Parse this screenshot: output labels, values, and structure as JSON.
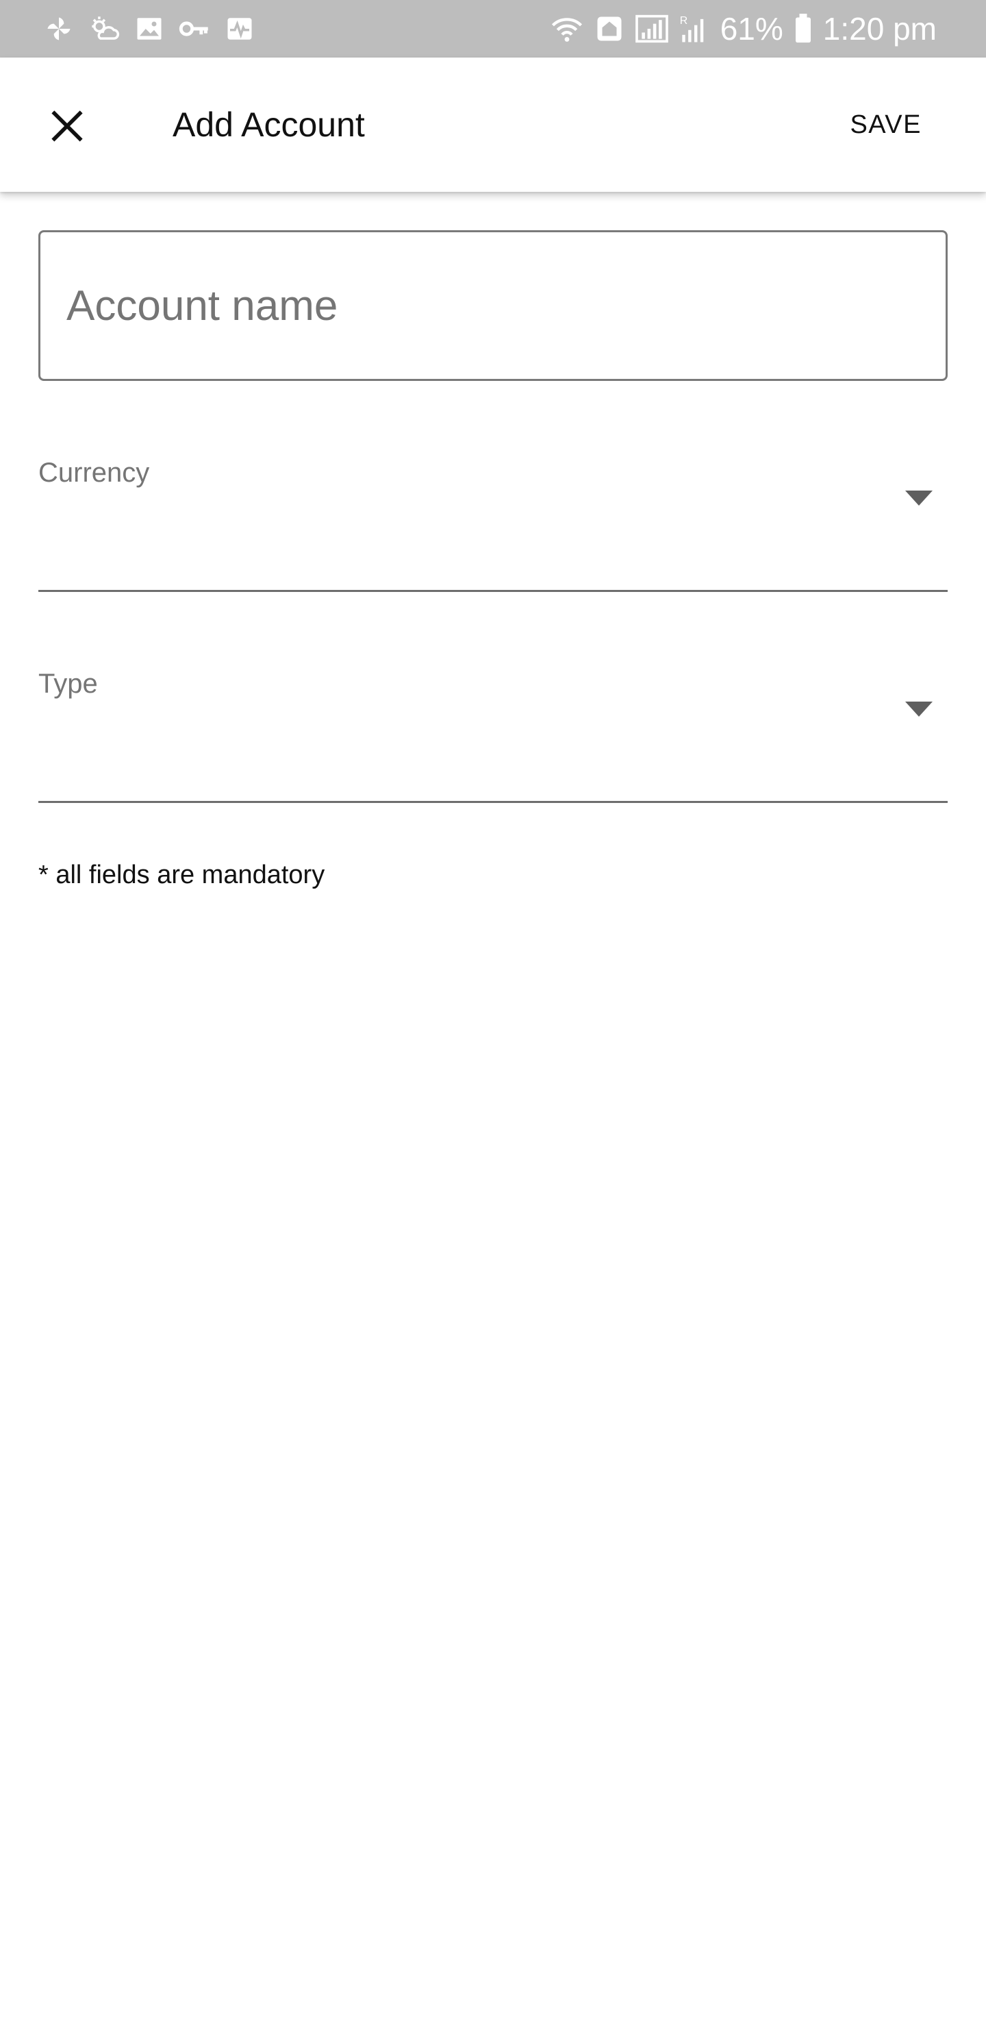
{
  "status_bar": {
    "battery": "61%",
    "time": "1:20 pm",
    "left_icons": [
      "pinwheel-icon",
      "weather-icon",
      "image-icon",
      "key-icon",
      "activity-icon"
    ],
    "right_icons": [
      "wifi-icon",
      "home-icon",
      "signal-icon",
      "roaming-signal-icon",
      "battery-icon"
    ]
  },
  "app_bar": {
    "title": "Add Account",
    "save_label": "SAVE",
    "close_icon": "close-icon"
  },
  "form": {
    "account_name": {
      "placeholder": "Account name",
      "value": ""
    },
    "currency": {
      "label": "Currency",
      "value": ""
    },
    "type": {
      "label": "Type",
      "value": ""
    },
    "hint": "* all fields are mandatory"
  },
  "colors": {
    "status_bar": "#bdbdbd",
    "text_primary": "#111111",
    "text_secondary": "#757575",
    "border": "#7a7a7a"
  }
}
